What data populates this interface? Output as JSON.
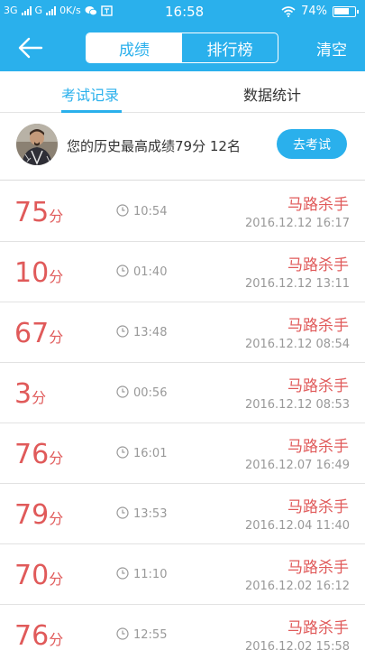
{
  "status_bar": {
    "network1": "3G",
    "network2": "G",
    "speed": "0K/s",
    "time": "16:58",
    "battery": "74%"
  },
  "nav": {
    "back_icon": "arrow-left-icon",
    "tabs": [
      "成绩",
      "排行榜"
    ],
    "active_tab": "成绩",
    "clear_label": "清空"
  },
  "sub_tabs": {
    "items": [
      "考试记录",
      "数据统计"
    ],
    "active": "考试记录"
  },
  "summary": {
    "text": "您的历史最高成绩79分  12名",
    "button_label": "去考试"
  },
  "records": [
    {
      "score": "75",
      "unit": "分",
      "duration": "10:54",
      "name": "马路杀手",
      "date": "2016.12.12  16:17"
    },
    {
      "score": "10",
      "unit": "分",
      "duration": "01:40",
      "name": "马路杀手",
      "date": "2016.12.12  13:11"
    },
    {
      "score": "67",
      "unit": "分",
      "duration": "13:48",
      "name": "马路杀手",
      "date": "2016.12.12  08:54"
    },
    {
      "score": "3",
      "unit": "分",
      "duration": "00:56",
      "name": "马路杀手",
      "date": "2016.12.12  08:53"
    },
    {
      "score": "76",
      "unit": "分",
      "duration": "16:01",
      "name": "马路杀手",
      "date": "2016.12.07  16:49"
    },
    {
      "score": "79",
      "unit": "分",
      "duration": "13:53",
      "name": "马路杀手",
      "date": "2016.12.04  11:40"
    },
    {
      "score": "70",
      "unit": "分",
      "duration": "11:10",
      "name": "马路杀手",
      "date": "2016.12.02  16:12"
    },
    {
      "score": "76",
      "unit": "分",
      "duration": "12:55",
      "name": "马路杀手",
      "date": "2016.12.02  15:58"
    }
  ],
  "colors": {
    "accent": "#2ab0ec",
    "score_red": "#e05a5a",
    "muted": "#999999"
  }
}
